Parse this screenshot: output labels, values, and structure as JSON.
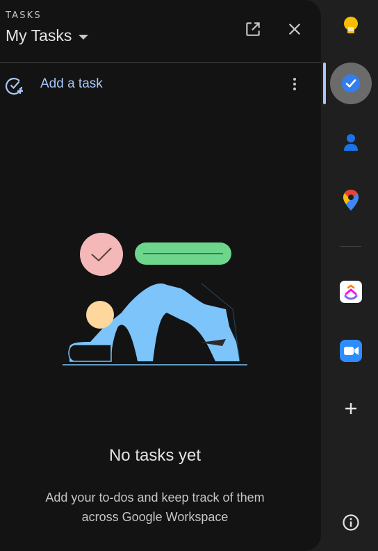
{
  "header": {
    "eyebrow": "TASKS",
    "title": "My Tasks",
    "icons": [
      "open-in-new-icon",
      "close-icon",
      "caret-down-icon"
    ]
  },
  "add_task": {
    "label": "Add a task",
    "icon": "add-task-icon",
    "menu_icon": "more-vert-icon"
  },
  "empty_state": {
    "title": "No tasks yet",
    "subtitle": "Add your to-dos and keep track of them across Google Workspace"
  },
  "side_rail": {
    "items": [
      "keep-icon",
      "tasks-icon",
      "contacts-icon",
      "maps-icon",
      "clickup-icon",
      "zoom-icon",
      "add-icon",
      "info-icon"
    ],
    "active": "tasks-icon"
  },
  "colors": {
    "accent": "#a8c7fa",
    "panel_bg": "#131313",
    "rail_bg": "#1f1f1f"
  }
}
